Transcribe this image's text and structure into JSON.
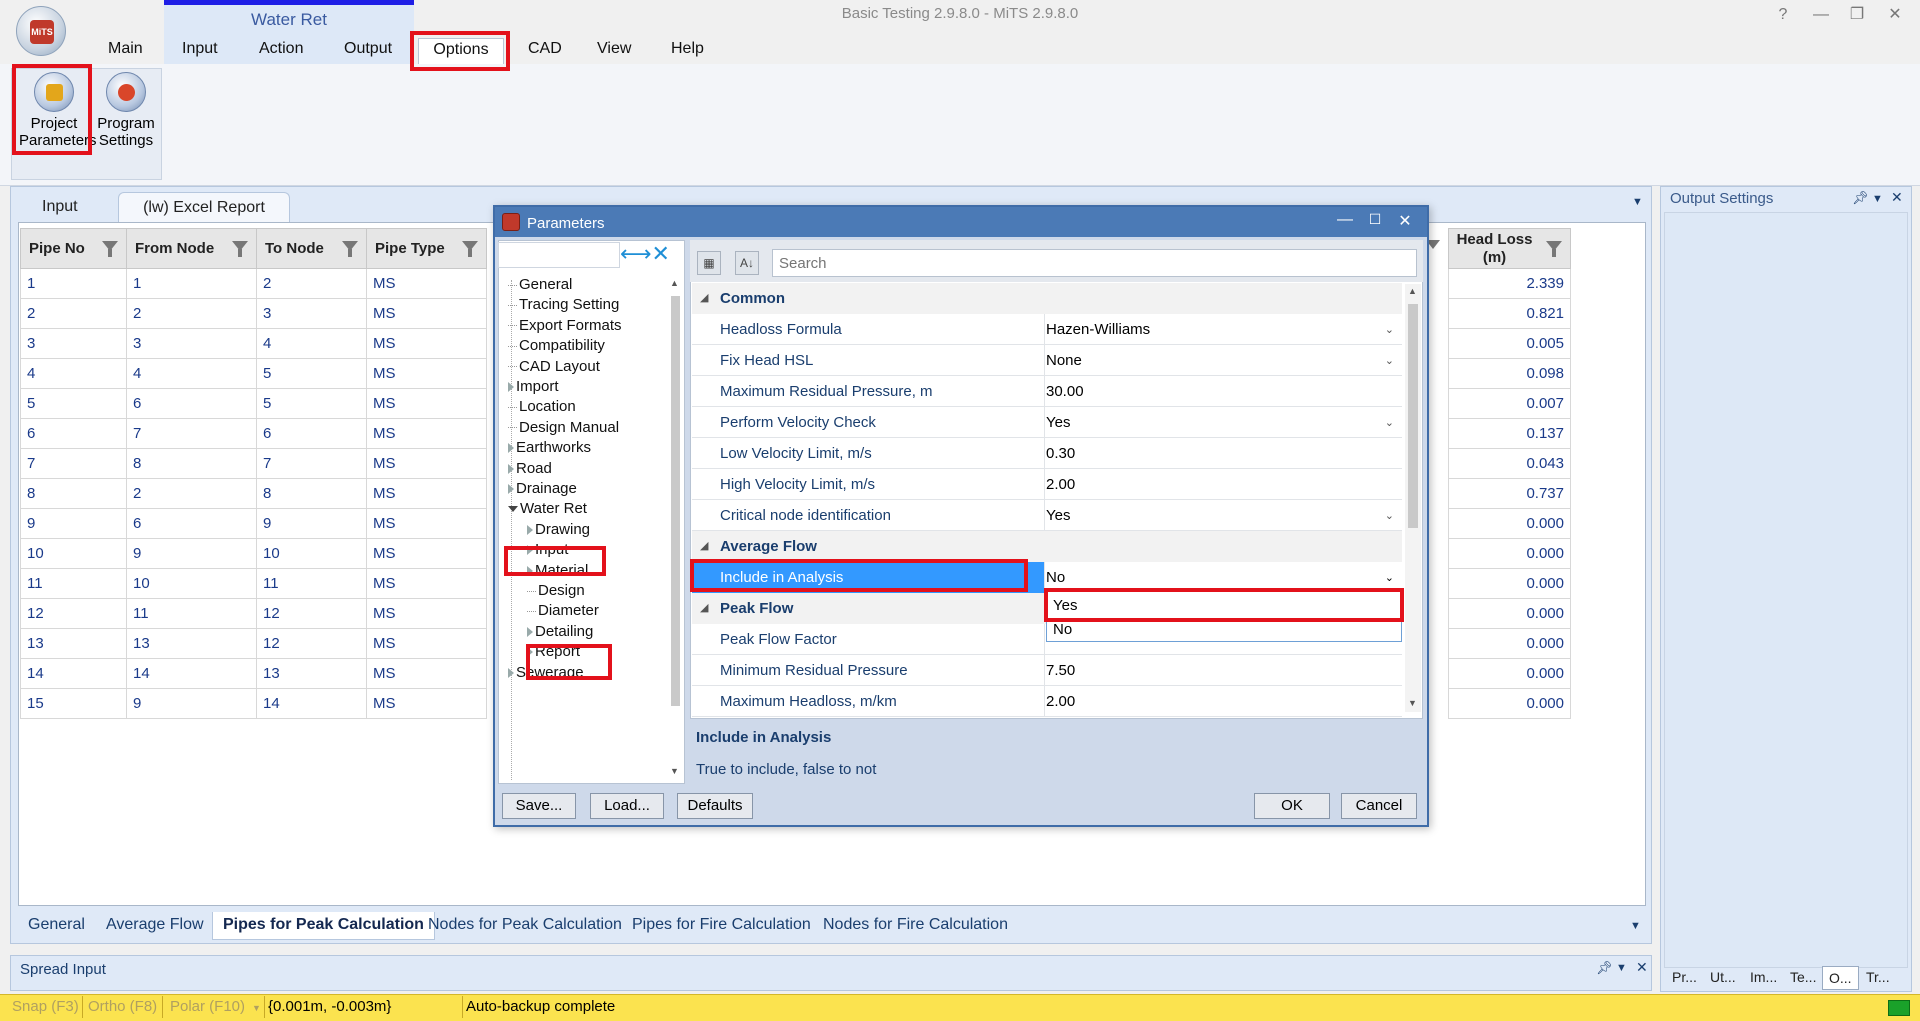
{
  "window": {
    "title": "Basic Testing 2.9.8.0 - MiTS 2.9.8.0",
    "help_btn": "?",
    "min_btn": "—",
    "restore_btn": "❐",
    "close_btn": "✕"
  },
  "app_logo_text": "MiTS",
  "ribbon": {
    "context_label": "Water Ret",
    "tabs": [
      "Main",
      "Input",
      "Action",
      "Output",
      "Options",
      "CAD",
      "View",
      "Help"
    ],
    "active_tab": "Options",
    "buttons": [
      {
        "line1": "Project",
        "line2": "Parameters"
      },
      {
        "line1": "Program",
        "line2": "Settings"
      }
    ]
  },
  "doc_tabs": [
    "Input",
    "(lw) Excel Report"
  ],
  "active_doc_tab": "(lw) Excel Report",
  "grid": {
    "columns": [
      "Pipe No",
      "From Node",
      "To Node",
      "Pipe Type"
    ],
    "rows": [
      [
        "1",
        "1",
        "2",
        "MS"
      ],
      [
        "2",
        "2",
        "3",
        "MS"
      ],
      [
        "3",
        "3",
        "4",
        "MS"
      ],
      [
        "4",
        "4",
        "5",
        "MS"
      ],
      [
        "5",
        "6",
        "5",
        "MS"
      ],
      [
        "6",
        "7",
        "6",
        "MS"
      ],
      [
        "7",
        "8",
        "7",
        "MS"
      ],
      [
        "8",
        "2",
        "8",
        "MS"
      ],
      [
        "9",
        "6",
        "9",
        "MS"
      ],
      [
        "10",
        "9",
        "10",
        "MS"
      ],
      [
        "11",
        "10",
        "11",
        "MS"
      ],
      [
        "12",
        "11",
        "12",
        "MS"
      ],
      [
        "13",
        "13",
        "12",
        "MS"
      ],
      [
        "14",
        "14",
        "13",
        "MS"
      ],
      [
        "15",
        "9",
        "14",
        "MS"
      ]
    ],
    "head_loss_header_1": "Head Loss",
    "head_loss_header_2": "(m)",
    "head_loss": [
      "2.339",
      "0.821",
      "0.005",
      "0.098",
      "0.007",
      "0.137",
      "0.043",
      "0.737",
      "0.000",
      "0.000",
      "0.000",
      "0.000",
      "0.000",
      "0.000",
      "0.000"
    ]
  },
  "bottom_tabs": [
    "General",
    "Average Flow",
    "Pipes for Peak Calculation",
    "Nodes for Peak Calculation",
    "Pipes for Fire Calculation",
    "Nodes for Fire Calculation"
  ],
  "active_bottom_tab": "Pipes for Peak Calculation",
  "spread_input": {
    "title": "Spread Input"
  },
  "output_settings": {
    "title": "Output Settings",
    "tabs": [
      "Pr...",
      "Ut...",
      "Im...",
      "Te...",
      "O...",
      "Tr..."
    ],
    "active_tab": "O..."
  },
  "status": {
    "snap": "Snap (F3)",
    "ortho": "Ortho (F8)",
    "polar": "Polar (F10)",
    "coords": "{0.001m, -0.003m}",
    "message": "Auto-backup complete"
  },
  "dialog": {
    "title": "Parameters",
    "tree": [
      {
        "label": "General",
        "level": 0,
        "arrow": "none"
      },
      {
        "label": "Tracing Setting",
        "level": 0,
        "arrow": "none"
      },
      {
        "label": "Export Formats",
        "level": 0,
        "arrow": "none"
      },
      {
        "label": "Compatibility",
        "level": 0,
        "arrow": "none"
      },
      {
        "label": "CAD Layout",
        "level": 0,
        "arrow": "none"
      },
      {
        "label": "Import",
        "level": 0,
        "arrow": "right"
      },
      {
        "label": "Location",
        "level": 0,
        "arrow": "none"
      },
      {
        "label": "Design Manual",
        "level": 0,
        "arrow": "none"
      },
      {
        "label": "Earthworks",
        "level": 0,
        "arrow": "right"
      },
      {
        "label": "Road",
        "level": 0,
        "arrow": "right"
      },
      {
        "label": "Drainage",
        "level": 0,
        "arrow": "right"
      },
      {
        "label": "Water Ret",
        "level": 0,
        "arrow": "down"
      },
      {
        "label": "Drawing",
        "level": 1,
        "arrow": "right"
      },
      {
        "label": "Input",
        "level": 1,
        "arrow": "right"
      },
      {
        "label": "Material",
        "level": 1,
        "arrow": "right"
      },
      {
        "label": "Design",
        "level": 1,
        "arrow": "none"
      },
      {
        "label": "Diameter",
        "level": 1,
        "arrow": "none"
      },
      {
        "label": "Detailing",
        "level": 1,
        "arrow": "right"
      },
      {
        "label": "Report",
        "level": 1,
        "arrow": "right"
      },
      {
        "label": "Sewerage",
        "level": 0,
        "arrow": "right"
      }
    ],
    "search_placeholder": "Search",
    "categories": {
      "common": "Common",
      "average": "Average Flow",
      "peak": "Peak Flow"
    },
    "properties": {
      "headloss_formula": {
        "name": "Headloss Formula",
        "value": "Hazen-Williams"
      },
      "fix_head": {
        "name": "Fix Head HSL",
        "value": "None"
      },
      "max_residual": {
        "name": "Maximum Residual Pressure, m",
        "value": "30.00"
      },
      "velocity_check": {
        "name": "Perform Velocity Check",
        "value": "Yes"
      },
      "low_velocity": {
        "name": "Low Velocity Limit, m/s",
        "value": "0.30"
      },
      "high_velocity": {
        "name": "High Velocity Limit, m/s",
        "value": "2.00"
      },
      "critical_node": {
        "name": "Critical node identification",
        "value": "Yes"
      },
      "include_analysis": {
        "name": "Include in Analysis",
        "value": "No"
      },
      "peak_factor": {
        "name": "Peak Flow Factor",
        "value": ""
      },
      "min_residual": {
        "name": "Minimum Residual Pressure",
        "value": "7.50"
      },
      "max_headloss": {
        "name": "Maximum Headloss, m/km",
        "value": "2.00"
      }
    },
    "dropdown_options": [
      "Yes",
      "No"
    ],
    "description_title": "Include in Analysis",
    "description_text": "True to include, false to not",
    "buttons": {
      "save": "Save...",
      "load": "Load...",
      "defaults": "Defaults",
      "ok": "OK",
      "cancel": "Cancel"
    }
  }
}
